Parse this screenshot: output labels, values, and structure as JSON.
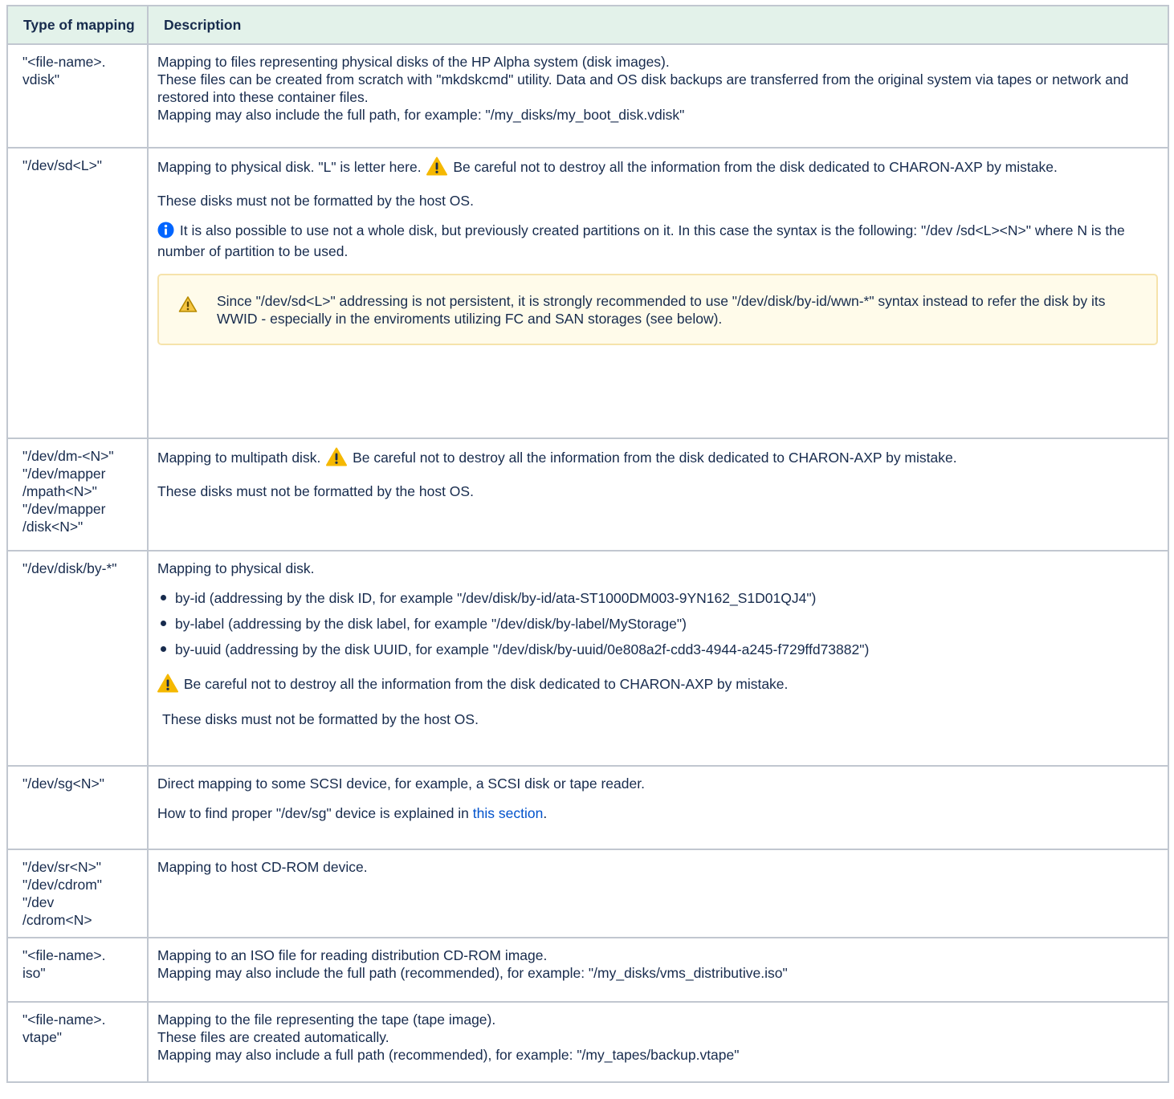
{
  "header": {
    "type_label": "Type of mapping",
    "desc_label": "Description"
  },
  "rows": [
    {
      "type": "\"<file-name>.\nvdisk\"",
      "lines": [
        "Mapping to files representing physical disks of the HP Alpha system (disk images).",
        "These files can be created from scratch with \"mkdskcmd\" utility. Data and OS disk backups are transferred from the original system via tapes or network and restored into these container files.",
        "Mapping may also include the full path, for example: \"/my_disks/my_boot_disk.vdisk\""
      ]
    },
    {
      "type": "\"/dev/sd<L>\"",
      "p1_a": "Mapping to physical disk. \"L\" is letter here.",
      "p1_b": "Be careful not to destroy all the information from the disk dedicated to CHARON-AXP by mistake.",
      "p2": "These disks must not be formatted by the host OS.",
      "p3": "It is also possible to use not a whole disk, but previously created partitions on it. In this case the syntax is the following: \"/dev /sd<L><N>\" where N is the number of partition to be used.",
      "note": "Since \"/dev/sd<L>\" addressing is not persistent, it is strongly recommended to use \"/dev/disk/by-id/wwn-*\" syntax instead to refer the disk by its WWID - especially in the enviroments utilizing FC and SAN storages (see below)."
    },
    {
      "type": "\"/dev/dm-<N>\"\n\"/dev/mapper\n/mpath<N>\"\n\"/dev/mapper\n/disk<N>\"",
      "p1_a": "Mapping to multipath disk.",
      "p1_b": "Be careful not to destroy all the information from the disk dedicated to CHARON-AXP by mistake.",
      "p2": "These disks must not be formatted by the host OS."
    },
    {
      "type": "\"/dev/disk/by-*\"",
      "p1": "Mapping to physical disk.",
      "items": [
        "by-id (addressing by the disk ID, for example \"/dev/disk/by-id/ata-ST1000DM003-9YN162_S1D01QJ4\")",
        "by-label (addressing by the disk label, for example \"/dev/disk/by-label/MyStorage\")",
        "by-uuid (addressing by the disk UUID, for example \"/dev/disk/by-uuid/0e808a2f-cdd3-4944-a245-f729ffd73882\")"
      ],
      "warn": "Be careful not to destroy all the information from the disk dedicated to CHARON-AXP by mistake.",
      "p2": "These disks must not be formatted by the host OS."
    },
    {
      "type": "\"/dev/sg<N>\"",
      "p1": "Direct mapping to some SCSI device, for example, a SCSI disk or tape reader.",
      "p2_a": "How to find proper \"/dev/sg\" device is explained in ",
      "p2_link": "this section",
      "p2_b": "."
    },
    {
      "type": "\"/dev/sr<N>\"\n\"/dev/cdrom\"\n\"/dev\n/cdrom<N>",
      "p1": "Mapping to host CD-ROM device."
    },
    {
      "type": "\"<file-name>.\niso\"",
      "lines": [
        "Mapping to an ISO file for reading distribution CD-ROM image.",
        "Mapping may also include the full path (recommended), for example: \"/my_disks/vms_distributive.iso\""
      ]
    },
    {
      "type": "\"<file-name>.\nvtape\"",
      "lines": [
        "Mapping to the file representing the tape (tape image).",
        "These files are created automatically.",
        "Mapping may also include a full path (recommended), for example: \"/my_tapes/backup.vtape\""
      ]
    }
  ],
  "colors": {
    "header_bg": "#e3f2ea",
    "border": "#c1c7d0",
    "warning": "#f5b800",
    "info": "#0065ff",
    "link": "#0052cc",
    "note_bg": "#fffbea"
  },
  "icons": {
    "warning": "warning-icon",
    "info": "info-icon"
  }
}
